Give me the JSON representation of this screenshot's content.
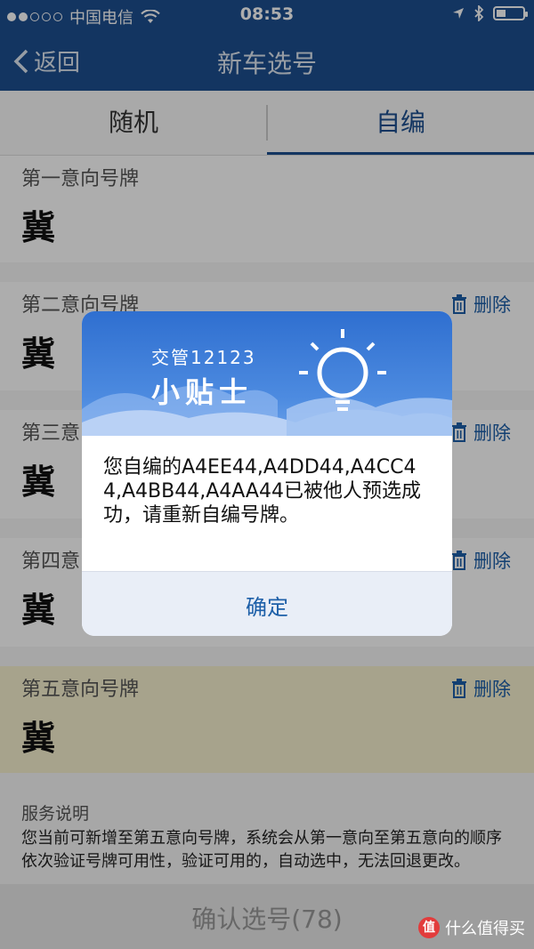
{
  "status": {
    "carrier": "中国电信",
    "time": "08:53"
  },
  "nav": {
    "back_label": "返回",
    "title": "新车选号"
  },
  "tabs": [
    {
      "label": "随机"
    },
    {
      "label": "自编"
    }
  ],
  "plates": [
    {
      "label": "第一意向号牌",
      "prov": "冀"
    },
    {
      "label": "第二意向号牌",
      "prov": "冀",
      "delete_label": "删除"
    },
    {
      "label": "第三意向号牌",
      "prov": "冀",
      "delete_label": "删除"
    },
    {
      "label": "第四意向号牌",
      "prov": "冀",
      "delete_label": "删除"
    },
    {
      "label": "第五意向号牌",
      "prov": "冀",
      "delete_label": "删除"
    }
  ],
  "service": {
    "heading": "服务说明",
    "text": "您当前可新增至第五意向号牌，系统会从第一意向至第五意向的顺序依次验证号牌可用性，验证可用的，自动选中，无法回退更改。"
  },
  "confirm_button": "确认选号(78)",
  "dialog": {
    "brand": "交管12123",
    "title": "小贴士",
    "message": "您自编的A4EE44,A4DD44,A4CC44,A4BB44,A4AA44已被他人预选成功，请重新自编号牌。",
    "ok_label": "确定"
  },
  "watermark": {
    "logo_text": "值",
    "text": "什么值得买"
  },
  "colors": {
    "brand_blue": "#1d4f8f",
    "link_blue": "#1d5fa8",
    "highlight_yellow": "#f7f1cf"
  }
}
